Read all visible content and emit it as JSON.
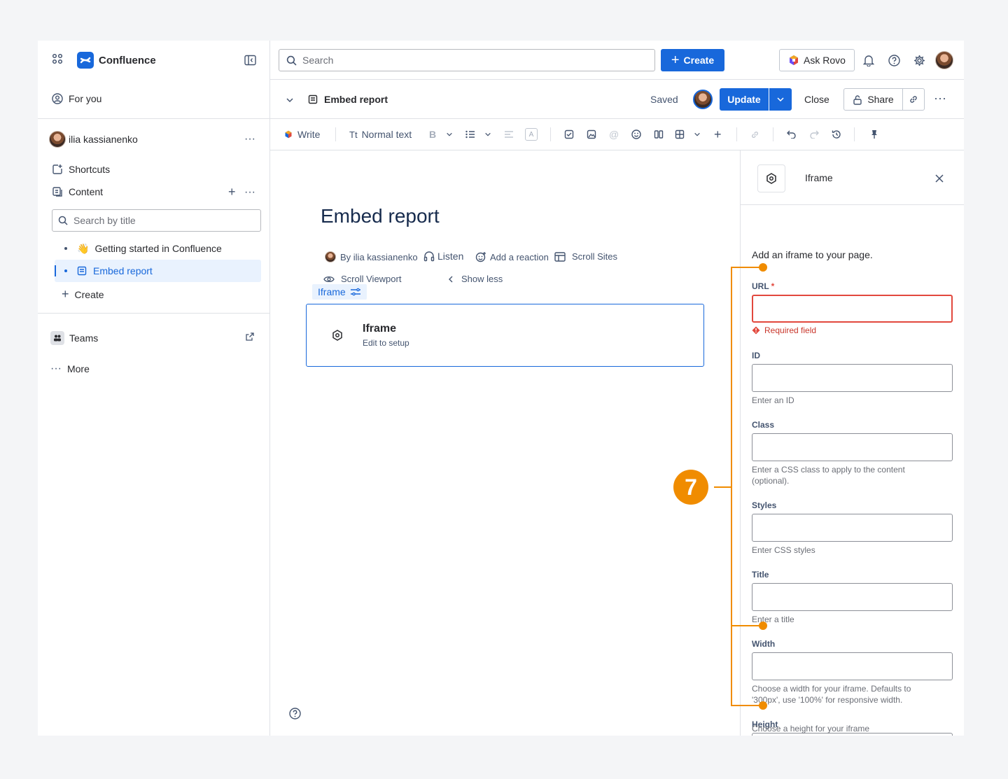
{
  "sidebar": {
    "app_name": "Confluence",
    "for_you": "For you",
    "user_name": "ilia kassianenko",
    "shortcuts": "Shortcuts",
    "content": "Content",
    "search_placeholder": "Search by title",
    "tree": [
      {
        "label": "Getting started in Confluence",
        "emoji": "👋"
      },
      {
        "label": "Embed report"
      }
    ],
    "create": "Create",
    "teams": "Teams",
    "more": "More"
  },
  "topbar": {
    "search_placeholder": "Search",
    "create": "Create",
    "ask_rovo": "Ask Rovo"
  },
  "pagebar": {
    "title": "Embed report",
    "saved": "Saved",
    "update": "Update",
    "close": "Close",
    "share": "Share"
  },
  "toolbar": {
    "write": "Write",
    "text_style": "Normal text",
    "bold": "B"
  },
  "editor": {
    "title": "Embed report",
    "by_author": "By ilia kassianenko",
    "listen": "Listen",
    "add_reaction": "Add a reaction",
    "scroll_sites": "Scroll Sites",
    "scroll_viewport": "Scroll Viewport",
    "show_less": "Show less",
    "macro_tag": "Iframe",
    "card_title": "Iframe",
    "card_subtitle": "Edit to setup"
  },
  "panel": {
    "title": "Iframe",
    "description": "Add an iframe to your page.",
    "fields": [
      {
        "label": "URL",
        "required": "*",
        "error": "Required field"
      },
      {
        "label": "ID",
        "help": "Enter an ID"
      },
      {
        "label": "Class",
        "help": "Enter a CSS class to apply to the content (optional)."
      },
      {
        "label": "Styles",
        "help": "Enter CSS styles"
      },
      {
        "label": "Title",
        "help": "Enter a title"
      },
      {
        "label": "Width",
        "help": "Choose a width for your iframe. Defaults to '300px', use '100%' for responsive width."
      },
      {
        "label": "Height",
        "help": "Choose a height for your iframe"
      }
    ]
  },
  "annotation": {
    "number": "7",
    "color": "#f08c00"
  },
  "colors": {
    "brand": "#1868db",
    "error": "#e2483d"
  }
}
